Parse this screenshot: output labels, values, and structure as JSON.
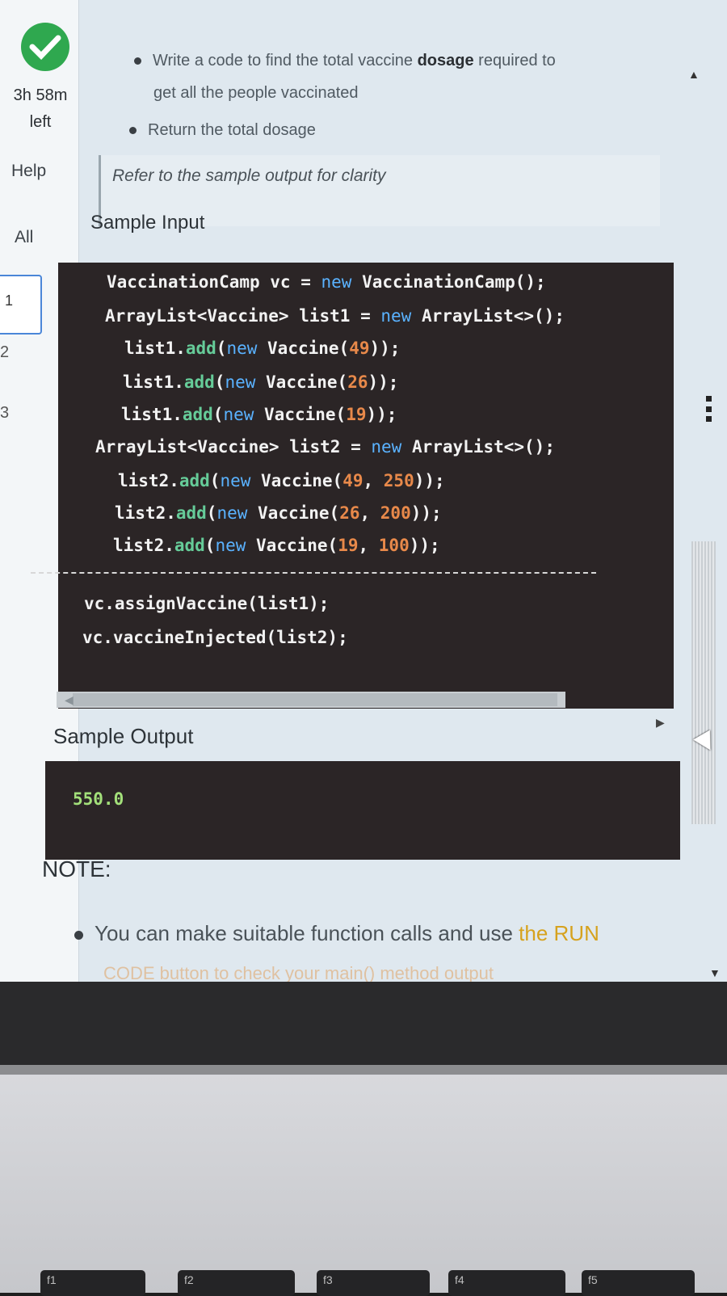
{
  "sidebar": {
    "timer_value": "3h 58m",
    "timer_suffix": "left",
    "help_label": "Help",
    "all_label": "All",
    "questions": [
      "1",
      "2",
      "3"
    ]
  },
  "problem": {
    "bullets": [
      {
        "text_before": "Write a code to find the total vaccine ",
        "bold": "dosage",
        "text_after": " required to"
      },
      {
        "text": "get all the people vaccinated"
      },
      {
        "text": "Return the total dosage"
      }
    ],
    "hint": "Refer to the sample output for clarity",
    "sample_input_title": "Sample Input",
    "sample_output_title": "Sample Output",
    "note_title": "NOTE:",
    "note_text": "You can make suitable function calls and use ",
    "note_link": "the RUN",
    "note_cut": "CODE button to check your main() method output"
  },
  "sample_input": {
    "lines": [
      {
        "segments": [
          {
            "t": "VaccinationCamp vc = ",
            "c": "fn"
          },
          {
            "t": "new",
            "c": "kw"
          },
          {
            "t": " VaccinationCamp();",
            "c": "fn"
          }
        ]
      },
      {
        "segments": [
          {
            "t": "ArrayList<Vaccine> list1 = ",
            "c": "fn"
          },
          {
            "t": "new",
            "c": "kw"
          },
          {
            "t": " ArrayList<>();",
            "c": "fn"
          }
        ]
      },
      {
        "segments": [
          {
            "t": "list1.",
            "c": "fn"
          },
          {
            "t": "add",
            "c": "mt"
          },
          {
            "t": "(",
            "c": "fn"
          },
          {
            "t": "new",
            "c": "kw"
          },
          {
            "t": " Vaccine(",
            "c": "fn"
          },
          {
            "t": "49",
            "c": "num"
          },
          {
            "t": "));",
            "c": "fn"
          }
        ]
      },
      {
        "segments": [
          {
            "t": "list1.",
            "c": "fn"
          },
          {
            "t": "add",
            "c": "mt"
          },
          {
            "t": "(",
            "c": "fn"
          },
          {
            "t": "new",
            "c": "kw"
          },
          {
            "t": " Vaccine(",
            "c": "fn"
          },
          {
            "t": "26",
            "c": "num"
          },
          {
            "t": "));",
            "c": "fn"
          }
        ]
      },
      {
        "segments": [
          {
            "t": "list1.",
            "c": "fn"
          },
          {
            "t": "add",
            "c": "mt"
          },
          {
            "t": "(",
            "c": "fn"
          },
          {
            "t": "new",
            "c": "kw"
          },
          {
            "t": " Vaccine(",
            "c": "fn"
          },
          {
            "t": "19",
            "c": "num"
          },
          {
            "t": "));",
            "c": "fn"
          }
        ]
      },
      {
        "segments": [
          {
            "t": "ArrayList<Vaccine> list2 = ",
            "c": "fn"
          },
          {
            "t": "new",
            "c": "kw"
          },
          {
            "t": " ArrayList<>();",
            "c": "fn"
          }
        ]
      },
      {
        "segments": [
          {
            "t": "list2.",
            "c": "fn"
          },
          {
            "t": "add",
            "c": "mt"
          },
          {
            "t": "(",
            "c": "fn"
          },
          {
            "t": "new",
            "c": "kw"
          },
          {
            "t": " Vaccine(",
            "c": "fn"
          },
          {
            "t": "49",
            "c": "num"
          },
          {
            "t": ", ",
            "c": "fn"
          },
          {
            "t": "250",
            "c": "num"
          },
          {
            "t": "));",
            "c": "fn"
          }
        ]
      },
      {
        "segments": [
          {
            "t": "list2.",
            "c": "fn"
          },
          {
            "t": "add",
            "c": "mt"
          },
          {
            "t": "(",
            "c": "fn"
          },
          {
            "t": "new",
            "c": "kw"
          },
          {
            "t": " Vaccine(",
            "c": "fn"
          },
          {
            "t": "26",
            "c": "num"
          },
          {
            "t": ", ",
            "c": "fn"
          },
          {
            "t": "200",
            "c": "num"
          },
          {
            "t": "));",
            "c": "fn"
          }
        ]
      },
      {
        "segments": [
          {
            "t": "list2.",
            "c": "fn"
          },
          {
            "t": "add",
            "c": "mt"
          },
          {
            "t": "(",
            "c": "fn"
          },
          {
            "t": "new",
            "c": "kw"
          },
          {
            "t": " Vaccine(",
            "c": "fn"
          },
          {
            "t": "19",
            "c": "num"
          },
          {
            "t": ", ",
            "c": "fn"
          },
          {
            "t": "100",
            "c": "num"
          },
          {
            "t": "));",
            "c": "fn"
          }
        ]
      },
      {
        "segments": [
          {
            "t": "vc.assignVaccine(list1);",
            "c": "fn"
          }
        ]
      },
      {
        "segments": [
          {
            "t": "vc.vaccineInjected(list2);",
            "c": "fn"
          }
        ]
      }
    ]
  },
  "sample_output": {
    "value": "550.0"
  },
  "keyboard": {
    "fkeys": [
      "f1",
      "f2",
      "f3",
      "f4",
      "f5"
    ]
  },
  "colors": {
    "check": "#2fa84f",
    "code_bg": "#2b2526",
    "keyword": "#5ab2ff",
    "number": "#e8894a",
    "method": "#66cc99",
    "link": "#d6a21e"
  }
}
